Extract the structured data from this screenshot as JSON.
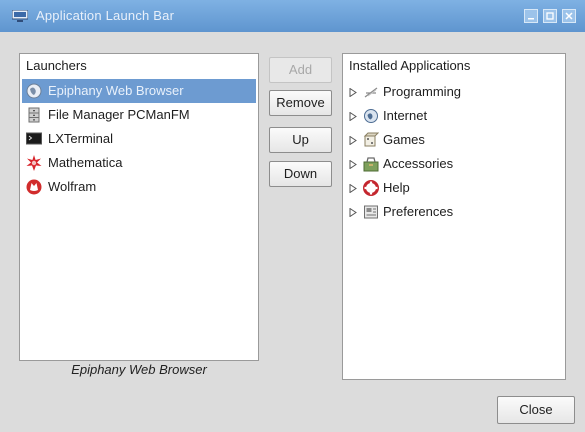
{
  "window": {
    "title": "Application Launch Bar",
    "controls": [
      "minimize-icon",
      "maximize-icon",
      "close-icon"
    ]
  },
  "launchers": {
    "header": "Launchers",
    "selected_index": 0,
    "items": [
      {
        "label": "Epiphany Web Browser",
        "icon": "globe-icon"
      },
      {
        "label": "File Manager PCManFM",
        "icon": "file-cabinet-icon"
      },
      {
        "label": "LXTerminal",
        "icon": "terminal-icon"
      },
      {
        "label": "Mathematica",
        "icon": "starburst-icon"
      },
      {
        "label": "Wolfram",
        "icon": "wolf-icon"
      }
    ],
    "caption": "Epiphany Web Browser"
  },
  "buttons": {
    "add": "Add",
    "remove": "Remove",
    "up": "Up",
    "down": "Down",
    "close": "Close"
  },
  "installed": {
    "header": "Installed Applications",
    "items": [
      {
        "label": "Programming",
        "icon": "compass-icon"
      },
      {
        "label": "Internet",
        "icon": "globe-icon"
      },
      {
        "label": "Games",
        "icon": "dice-icon"
      },
      {
        "label": "Accessories",
        "icon": "toolbox-icon"
      },
      {
        "label": "Help",
        "icon": "lifebuoy-icon"
      },
      {
        "label": "Preferences",
        "icon": "settings-icon"
      }
    ]
  },
  "colors": {
    "titlebar": "#6fa3d9",
    "selection": "#6d9bd1",
    "background": "#dcdcdc"
  }
}
